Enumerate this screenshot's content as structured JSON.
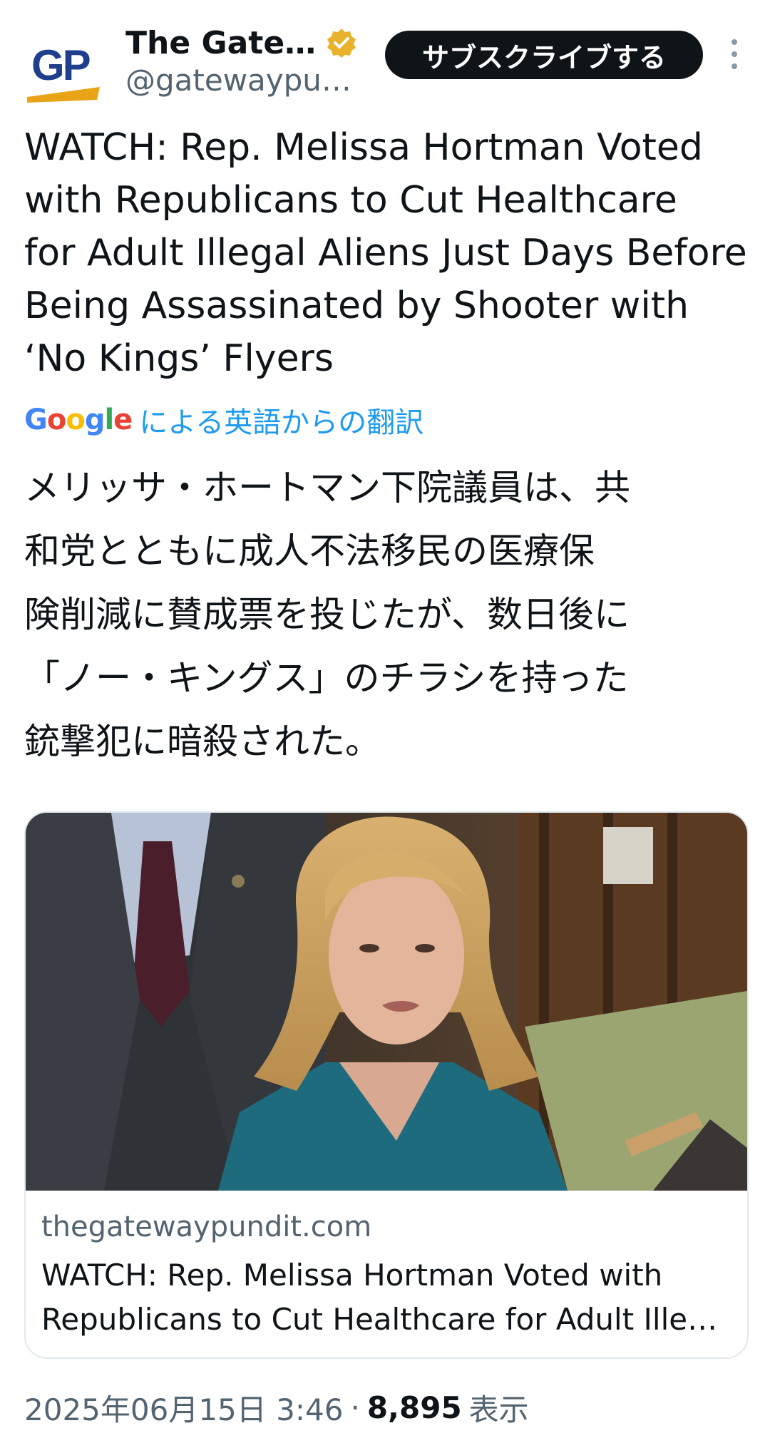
{
  "author": {
    "avatar_text": "GP",
    "display_name": "The Gate…",
    "handle": "@gatewaypu…",
    "verified": true,
    "verified_icon": "verified-badge-icon",
    "brand_color": "#1f3f8c",
    "accent_color": "#e8a317"
  },
  "subscribe_label": "サブスクライブする",
  "more_icon": "more-vertical-icon",
  "post": {
    "text_lines": [
      "WATCH: Rep. Melissa Hortman Voted",
      "with Republicans to Cut Healthcare",
      "for Adult Illegal Aliens Just Days Before",
      "Being Assassinated by Shooter with",
      "‘No Kings’ Flyers"
    ],
    "translation_source_logo": "Google",
    "translation_label": "による英語からの翻訳",
    "translated_lines": [
      "メリッサ・ホートマン下院議員は、共",
      "和党とともに成人不法移民の医療保",
      "険削減に賛成票を投じたが、数日後に",
      "「ノー・キングス」のチラシを持った",
      "銃撃犯に暗殺された。"
    ]
  },
  "link_card": {
    "domain": "thegatewaypundit.com",
    "title": "WATCH: Rep. Melissa Hortman Voted with Republicans to Cut Healthcare for Adult Ille…"
  },
  "meta": {
    "timestamp": "2025年06月15日 3:46",
    "separator": "·",
    "views": "8,895",
    "views_label": "表示"
  }
}
